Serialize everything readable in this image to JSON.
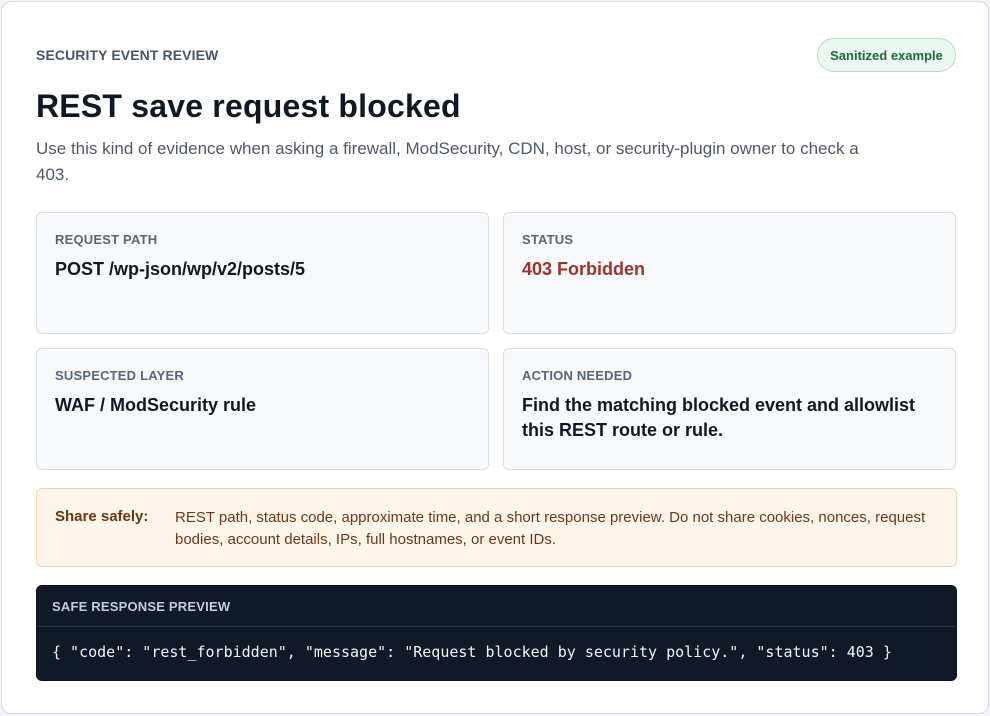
{
  "header": {
    "eyebrow": "SECURITY EVENT REVIEW",
    "badge": "Sanitized example",
    "title": "REST save request blocked",
    "description": "Use this kind of evidence when asking a firewall, ModSecurity, CDN, host, or security-plugin owner to check a 403."
  },
  "tiles": [
    {
      "label": "REQUEST PATH",
      "value": "POST /wp-json/wp/v2/posts/5"
    },
    {
      "label": "STATUS",
      "value": "403 Forbidden"
    },
    {
      "label": "SUSPECTED LAYER",
      "value": "WAF / ModSecurity rule"
    },
    {
      "label": "ACTION NEEDED",
      "value": "Find the matching blocked event and allowlist this REST route or rule."
    }
  ],
  "notice": {
    "label": "Share safely:",
    "text": "REST path, status code, approximate time, and a short response preview. Do not share cookies, nonces, request bodies, account details, IPs, full hostnames, or event IDs."
  },
  "preview": {
    "label": "SAFE RESPONSE PREVIEW",
    "code": "{ \"code\": \"rest_forbidden\", \"message\": \"Request blocked by security policy.\", \"status\": 403 }"
  },
  "colors": {
    "status_error": "#a0322b",
    "badge_green": "#1d6b38",
    "notice_bg": "#fff5eb",
    "preview_bg": "#111827"
  }
}
